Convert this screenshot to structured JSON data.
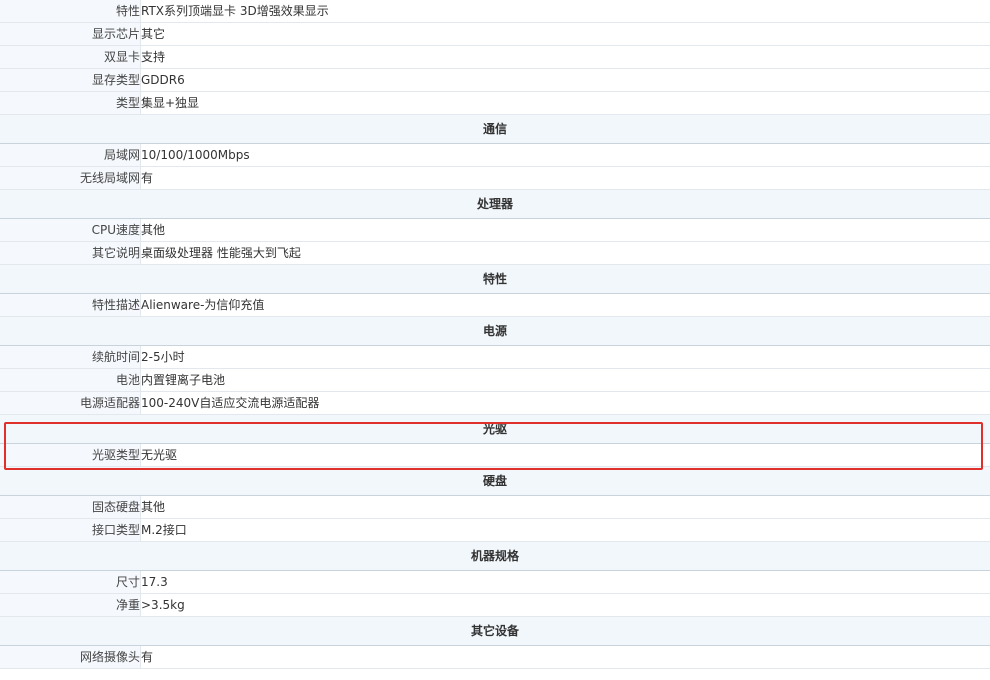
{
  "rows": [
    {
      "type": "kv",
      "key": "特性",
      "value": "RTX系列顶端显卡 3D增强效果显示"
    },
    {
      "type": "kv",
      "key": "显示芯片",
      "value": "其它"
    },
    {
      "type": "kv",
      "key": "双显卡",
      "value": "支持"
    },
    {
      "type": "kv",
      "key": "显存类型",
      "value": "GDDR6"
    },
    {
      "type": "kv",
      "key": "类型",
      "value": "集显+独显"
    },
    {
      "type": "section",
      "title": "通信"
    },
    {
      "type": "kv",
      "key": "局域网",
      "value": "10/100/1000Mbps"
    },
    {
      "type": "kv",
      "key": "无线局域网",
      "value": "有"
    },
    {
      "type": "section",
      "title": "处理器"
    },
    {
      "type": "kv",
      "key": "CPU速度",
      "value": "其他"
    },
    {
      "type": "kv",
      "key": "其它说明",
      "value": "桌面级处理器 性能强大到飞起"
    },
    {
      "type": "section",
      "title": "特性"
    },
    {
      "type": "kv",
      "key": "特性描述",
      "value": "Alienware-为信仰充值"
    },
    {
      "type": "section",
      "title": "电源"
    },
    {
      "type": "kv",
      "key": "续航时间",
      "value": "2-5小时"
    },
    {
      "type": "kv",
      "key": "电池",
      "value": "内置锂离子电池"
    },
    {
      "type": "kv",
      "key": "电源适配器",
      "value": "100-240V自适应交流电源适配器"
    },
    {
      "type": "section",
      "title": "光驱"
    },
    {
      "type": "kv",
      "key": "光驱类型",
      "value": "无光驱"
    },
    {
      "type": "section",
      "title": "硬盘"
    },
    {
      "type": "kv",
      "key": "固态硬盘",
      "value": "其他"
    },
    {
      "type": "kv",
      "key": "接口类型",
      "value": "M.2接口"
    },
    {
      "type": "section",
      "title": "机器规格"
    },
    {
      "type": "kv",
      "key": "尺寸",
      "value": "17.3"
    },
    {
      "type": "kv",
      "key": "净重",
      "value": ">3.5kg"
    },
    {
      "type": "section",
      "title": "其它设备"
    },
    {
      "type": "kv",
      "key": "网络摄像头",
      "value": "有"
    }
  ],
  "colors": {
    "highlight": "#e0302b",
    "key_bg": "#f5f9fd",
    "section_bg": "#f2f7fb"
  }
}
